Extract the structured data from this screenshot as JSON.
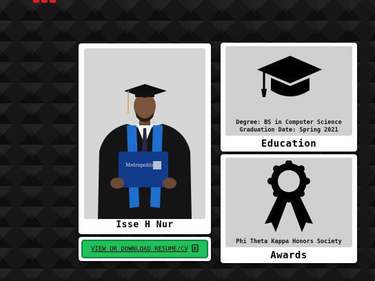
{
  "profile": {
    "name": "Isse H Nur"
  },
  "resume_button": {
    "label": "VIEW OR DOWNLOAD RESUME/CV",
    "icon": "document-icon"
  },
  "education": {
    "degree": "Degree: BS in Computer Science",
    "graduation": "Graduation Date: Spring 2021",
    "title": "Education",
    "icon": "graduation-cap-icon"
  },
  "awards": {
    "award": "Phi Theta Kappa Honors Society",
    "title": "Awards",
    "icon": "ribbon-award-icon"
  },
  "colors": {
    "accent_green": "#1fc25a",
    "logo_red": "#e02020",
    "background": "#161616"
  }
}
